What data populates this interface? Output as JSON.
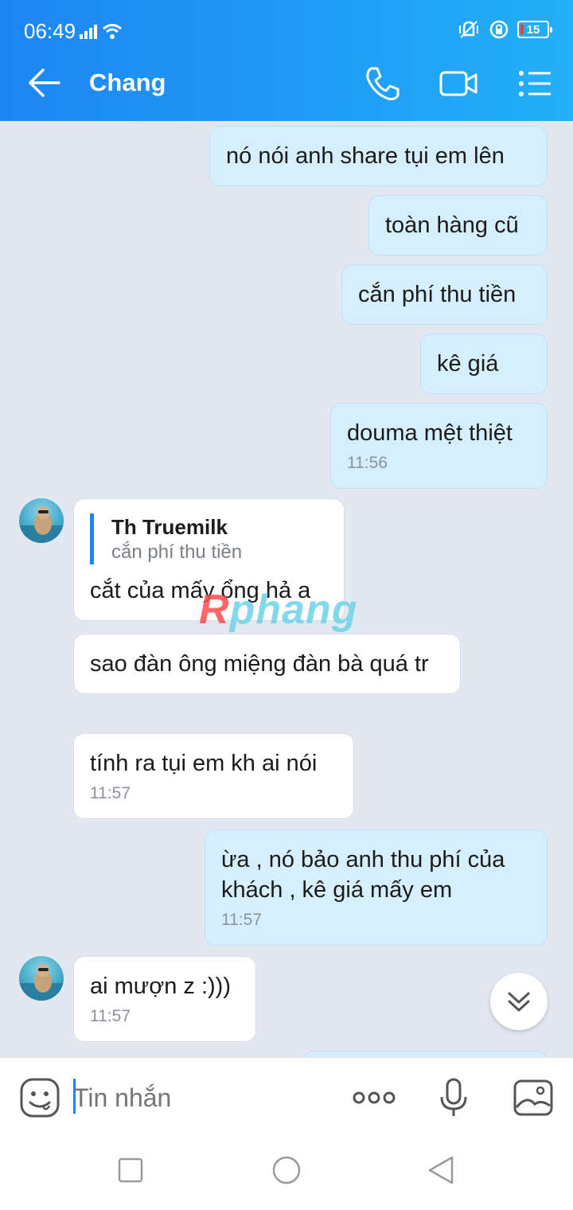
{
  "status_bar": {
    "time": "06:49",
    "battery": "15"
  },
  "header": {
    "title": "Chang",
    "back_icon": "arrow-left-icon",
    "call_icon": "phone-icon",
    "video_icon": "video-camera-icon",
    "menu_icon": "list-menu-icon"
  },
  "messages": [
    {
      "side": "out",
      "text": "nó nói anh share tụi em lên"
    },
    {
      "side": "out",
      "text": "toàn hàng cũ"
    },
    {
      "side": "out",
      "text": "cắn phí thu tiền"
    },
    {
      "side": "out",
      "text": "kê giá"
    },
    {
      "side": "out",
      "text": "douma mệt thiệt",
      "time": "11:56"
    },
    {
      "side": "in",
      "quote_name": "Th Truemilk",
      "quote_text": "cắn phí thu tiền",
      "text": "cắt của mấy ổng hả a"
    },
    {
      "side": "in",
      "text": "sao đàn ông miệng đàn bà quá tr"
    },
    {
      "side": "in",
      "text": "tính ra tụi em kh ai nói",
      "time": "11:57"
    },
    {
      "side": "out",
      "text": "ừa , nó bảo anh thu phí của khách , kê giá mấy em",
      "time": "11:57"
    },
    {
      "side": "in",
      "text": "ai mượn z :)))",
      "time": "11:57"
    }
  ],
  "watermark": {
    "r": "R",
    "rest": "phang"
  },
  "composer": {
    "placeholder": "Tin nhắn"
  },
  "colors": {
    "header_start": "#1e86f2",
    "header_end": "#22b0f7",
    "outgoing_bubble": "#d6efff",
    "incoming_bubble": "#ffffff",
    "background": "#e2e8f1"
  }
}
